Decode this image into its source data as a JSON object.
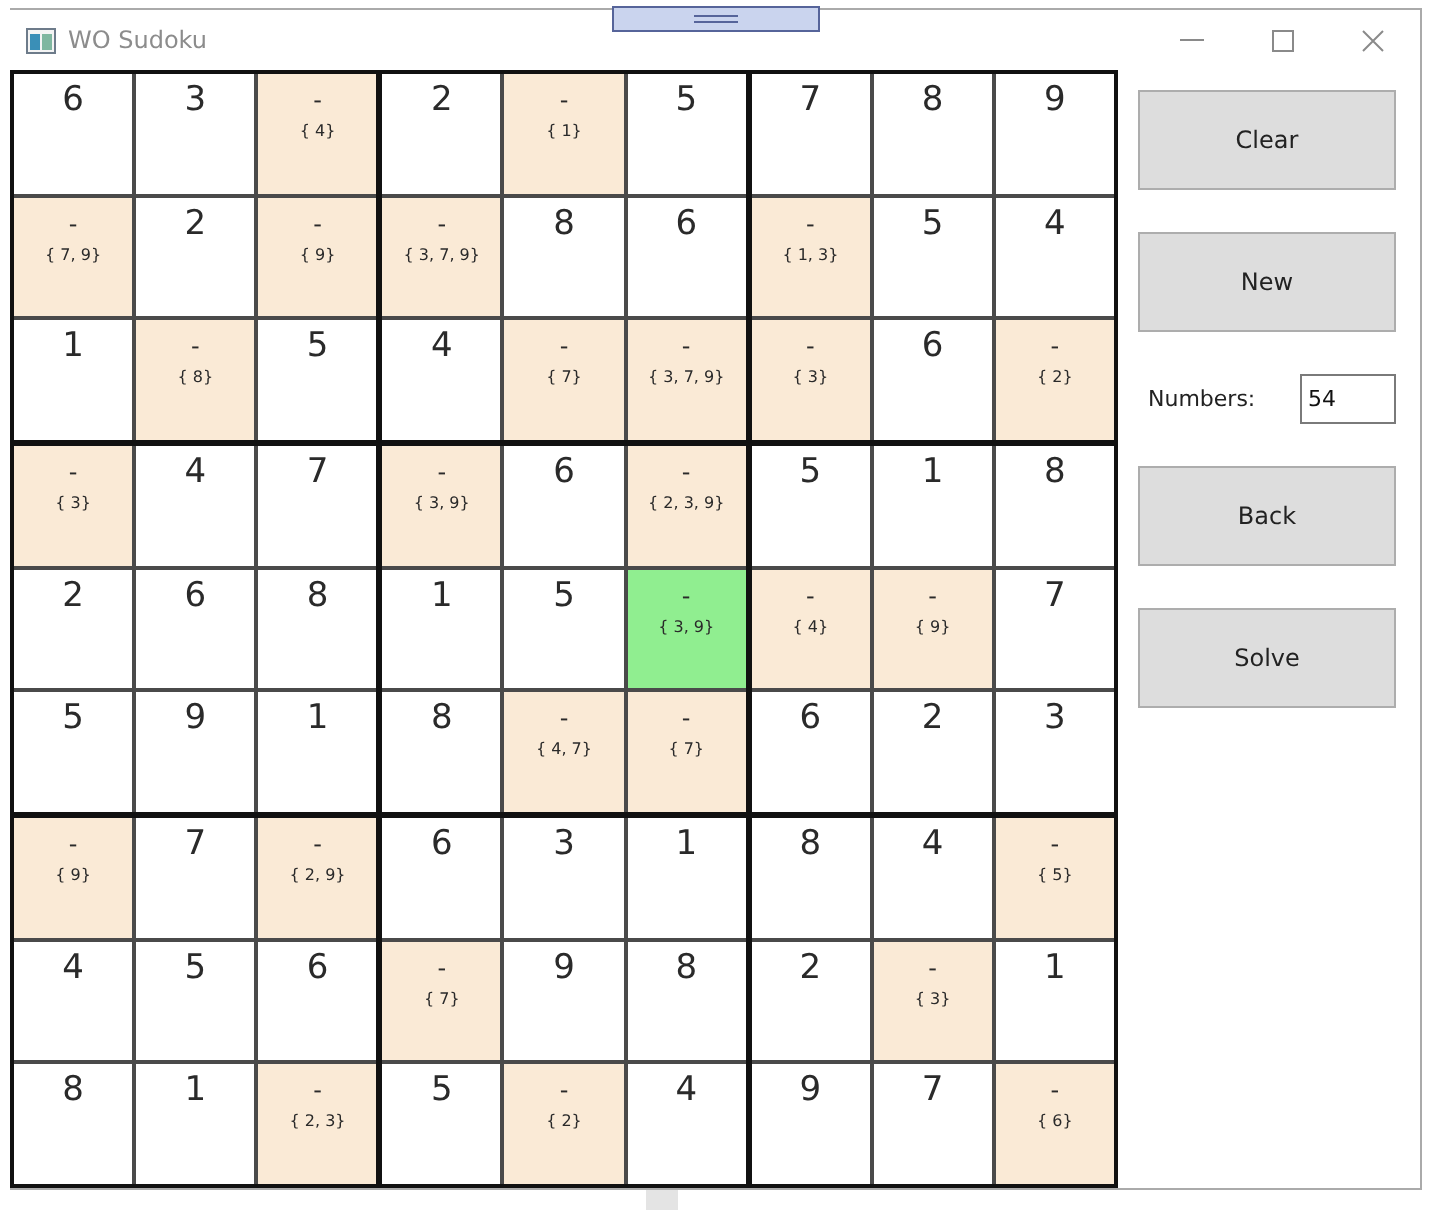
{
  "window": {
    "title": "WO Sudoku"
  },
  "grid": {
    "rows": [
      [
        {
          "kind": "given",
          "value": "6",
          "selected": false
        },
        {
          "kind": "given",
          "value": "3",
          "selected": false
        },
        {
          "kind": "open",
          "value": "-",
          "candidates": "{ 4}",
          "selected": false
        },
        {
          "kind": "given",
          "value": "2",
          "selected": false
        },
        {
          "kind": "open",
          "value": "-",
          "candidates": "{ 1}",
          "selected": false
        },
        {
          "kind": "given",
          "value": "5",
          "selected": false
        },
        {
          "kind": "given",
          "value": "7",
          "selected": false
        },
        {
          "kind": "given",
          "value": "8",
          "selected": false
        },
        {
          "kind": "given",
          "value": "9",
          "selected": false
        }
      ],
      [
        {
          "kind": "open",
          "value": "-",
          "candidates": "{ 7, 9}",
          "selected": false
        },
        {
          "kind": "given",
          "value": "2",
          "selected": false
        },
        {
          "kind": "open",
          "value": "-",
          "candidates": "{ 9}",
          "selected": false
        },
        {
          "kind": "open",
          "value": "-",
          "candidates": "{ 3, 7, 9}",
          "selected": false
        },
        {
          "kind": "given",
          "value": "8",
          "selected": false
        },
        {
          "kind": "given",
          "value": "6",
          "selected": false
        },
        {
          "kind": "open",
          "value": "-",
          "candidates": "{ 1, 3}",
          "selected": false
        },
        {
          "kind": "given",
          "value": "5",
          "selected": false
        },
        {
          "kind": "given",
          "value": "4",
          "selected": false
        }
      ],
      [
        {
          "kind": "given",
          "value": "1",
          "selected": false
        },
        {
          "kind": "open",
          "value": "-",
          "candidates": "{ 8}",
          "selected": false
        },
        {
          "kind": "given",
          "value": "5",
          "selected": false
        },
        {
          "kind": "given",
          "value": "4",
          "selected": false
        },
        {
          "kind": "open",
          "value": "-",
          "candidates": "{ 7}",
          "selected": false
        },
        {
          "kind": "open",
          "value": "-",
          "candidates": "{ 3, 7, 9}",
          "selected": false
        },
        {
          "kind": "open",
          "value": "-",
          "candidates": "{ 3}",
          "selected": false
        },
        {
          "kind": "given",
          "value": "6",
          "selected": false
        },
        {
          "kind": "open",
          "value": "-",
          "candidates": "{ 2}",
          "selected": false
        }
      ],
      [
        {
          "kind": "open",
          "value": "-",
          "candidates": "{ 3}",
          "selected": false
        },
        {
          "kind": "given",
          "value": "4",
          "selected": false
        },
        {
          "kind": "given",
          "value": "7",
          "selected": false
        },
        {
          "kind": "open",
          "value": "-",
          "candidates": "{ 3, 9}",
          "selected": false
        },
        {
          "kind": "given",
          "value": "6",
          "selected": false
        },
        {
          "kind": "open",
          "value": "-",
          "candidates": "{ 2, 3, 9}",
          "selected": false
        },
        {
          "kind": "given",
          "value": "5",
          "selected": false
        },
        {
          "kind": "given",
          "value": "1",
          "selected": false
        },
        {
          "kind": "given",
          "value": "8",
          "selected": false
        }
      ],
      [
        {
          "kind": "given",
          "value": "2",
          "selected": false
        },
        {
          "kind": "given",
          "value": "6",
          "selected": false
        },
        {
          "kind": "given",
          "value": "8",
          "selected": false
        },
        {
          "kind": "given",
          "value": "1",
          "selected": false
        },
        {
          "kind": "given",
          "value": "5",
          "selected": false
        },
        {
          "kind": "open",
          "value": "-",
          "candidates": "{ 3, 9}",
          "selected": true
        },
        {
          "kind": "open",
          "value": "-",
          "candidates": "{ 4}",
          "selected": false
        },
        {
          "kind": "open",
          "value": "-",
          "candidates": "{ 9}",
          "selected": false
        },
        {
          "kind": "given",
          "value": "7",
          "selected": false
        }
      ],
      [
        {
          "kind": "given",
          "value": "5",
          "selected": false
        },
        {
          "kind": "given",
          "value": "9",
          "selected": false
        },
        {
          "kind": "given",
          "value": "1",
          "selected": false
        },
        {
          "kind": "given",
          "value": "8",
          "selected": false
        },
        {
          "kind": "open",
          "value": "-",
          "candidates": "{ 4, 7}",
          "selected": false
        },
        {
          "kind": "open",
          "value": "-",
          "candidates": "{ 7}",
          "selected": false
        },
        {
          "kind": "given",
          "value": "6",
          "selected": false
        },
        {
          "kind": "given",
          "value": "2",
          "selected": false
        },
        {
          "kind": "given",
          "value": "3",
          "selected": false
        }
      ],
      [
        {
          "kind": "open",
          "value": "-",
          "candidates": "{ 9}",
          "selected": false
        },
        {
          "kind": "given",
          "value": "7",
          "selected": false
        },
        {
          "kind": "open",
          "value": "-",
          "candidates": "{ 2, 9}",
          "selected": false
        },
        {
          "kind": "given",
          "value": "6",
          "selected": false
        },
        {
          "kind": "given",
          "value": "3",
          "selected": false
        },
        {
          "kind": "given",
          "value": "1",
          "selected": false
        },
        {
          "kind": "given",
          "value": "8",
          "selected": false
        },
        {
          "kind": "given",
          "value": "4",
          "selected": false
        },
        {
          "kind": "open",
          "value": "-",
          "candidates": "{ 5}",
          "selected": false
        }
      ],
      [
        {
          "kind": "given",
          "value": "4",
          "selected": false
        },
        {
          "kind": "given",
          "value": "5",
          "selected": false
        },
        {
          "kind": "given",
          "value": "6",
          "selected": false
        },
        {
          "kind": "open",
          "value": "-",
          "candidates": "{ 7}",
          "selected": false
        },
        {
          "kind": "given",
          "value": "9",
          "selected": false
        },
        {
          "kind": "given",
          "value": "8",
          "selected": false
        },
        {
          "kind": "given",
          "value": "2",
          "selected": false
        },
        {
          "kind": "open",
          "value": "-",
          "candidates": "{ 3}",
          "selected": false
        },
        {
          "kind": "given",
          "value": "1",
          "selected": false
        }
      ],
      [
        {
          "kind": "given",
          "value": "8",
          "selected": false
        },
        {
          "kind": "given",
          "value": "1",
          "selected": false
        },
        {
          "kind": "open",
          "value": "-",
          "candidates": "{ 2, 3}",
          "selected": false
        },
        {
          "kind": "given",
          "value": "5",
          "selected": false
        },
        {
          "kind": "open",
          "value": "-",
          "candidates": "{ 2}",
          "selected": false
        },
        {
          "kind": "given",
          "value": "4",
          "selected": false
        },
        {
          "kind": "given",
          "value": "9",
          "selected": false
        },
        {
          "kind": "given",
          "value": "7",
          "selected": false
        },
        {
          "kind": "open",
          "value": "-",
          "candidates": "{ 6}",
          "selected": false
        }
      ]
    ]
  },
  "side_panel": {
    "controls": [
      {
        "kind": "button",
        "label": "Clear"
      },
      {
        "kind": "button",
        "label": "New"
      },
      {
        "kind": "field",
        "label": "Numbers:",
        "value": "54"
      },
      {
        "kind": "button",
        "label": "Back"
      },
      {
        "kind": "button",
        "label": "Solve"
      }
    ]
  }
}
